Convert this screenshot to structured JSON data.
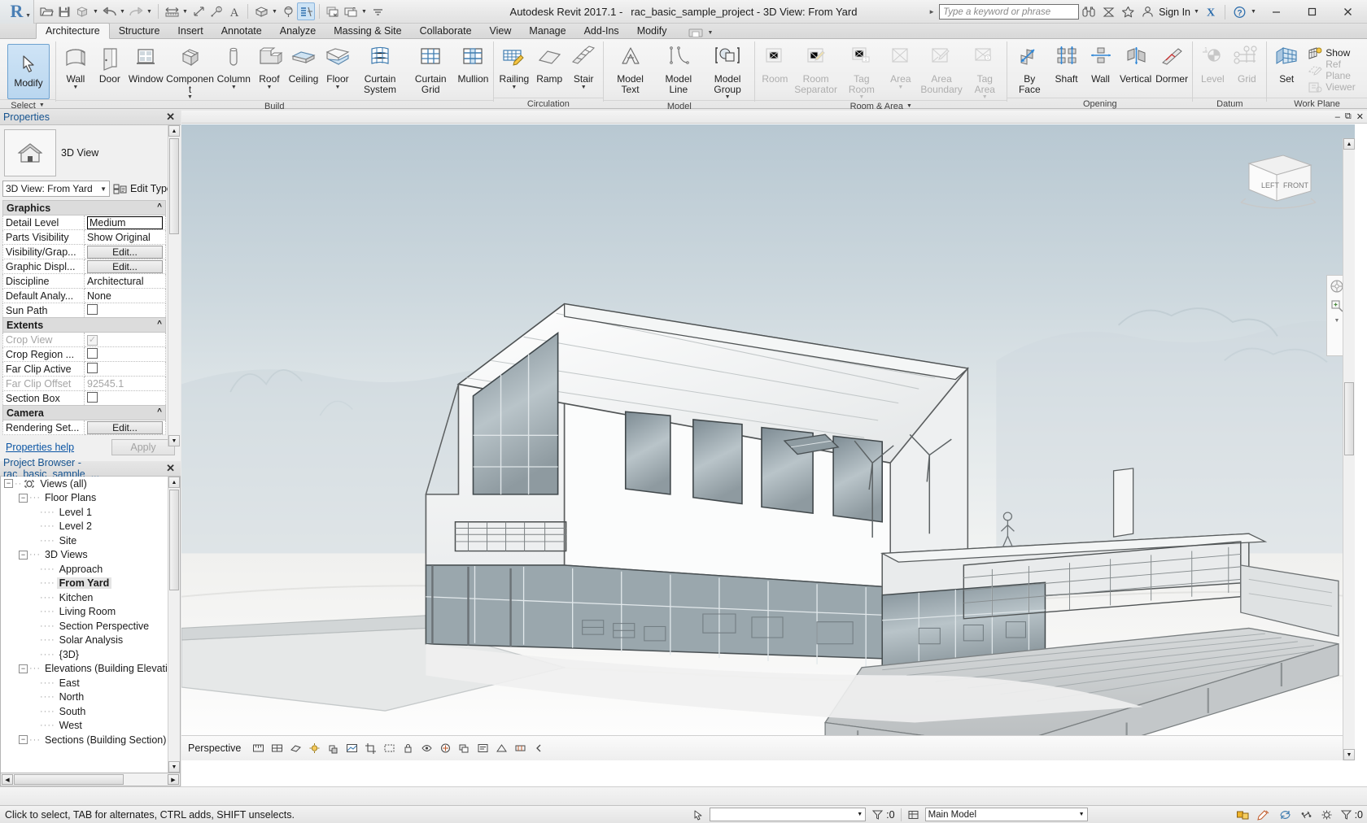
{
  "titlebar": {
    "app_title": "Autodesk Revit 2017.1 -",
    "document_title": "rac_basic_sample_project - 3D View: From Yard",
    "search_placeholder": "Type a keyword or phrase",
    "sign_in_label": "Sign In",
    "qat_items": [
      {
        "name": "open-icon",
        "label": "Open"
      },
      {
        "name": "save-icon",
        "label": "Save"
      },
      {
        "name": "export-icon",
        "label": "Export"
      },
      {
        "name": "undo-icon",
        "label": "Undo"
      },
      {
        "name": "redo-icon",
        "label": "Redo"
      },
      {
        "name": "measure-icon",
        "label": "Measure"
      },
      {
        "name": "aligned-dimension-icon",
        "label": "Aligned Dimension"
      },
      {
        "name": "tag-icon",
        "label": "Tag by Category"
      },
      {
        "name": "text-icon",
        "label": "Text"
      },
      {
        "name": "default-3d-view-icon",
        "label": "Default 3D View"
      },
      {
        "name": "section-icon",
        "label": "Section"
      },
      {
        "name": "thin-lines-icon",
        "label": "Thin Lines"
      },
      {
        "name": "close-hidden-windows-icon",
        "label": "Close Hidden Windows"
      },
      {
        "name": "switch-windows-icon",
        "label": "Switch Windows"
      },
      {
        "name": "customize-qat-icon",
        "label": "Customize Quick Access Toolbar"
      }
    ],
    "window_buttons": {
      "minimize": "–",
      "maximize": "❐",
      "close": "✕"
    }
  },
  "tabs": [
    {
      "label": "Architecture",
      "active": true
    },
    {
      "label": "Structure",
      "active": false
    },
    {
      "label": "Insert",
      "active": false
    },
    {
      "label": "Annotate",
      "active": false
    },
    {
      "label": "Analyze",
      "active": false
    },
    {
      "label": "Massing & Site",
      "active": false
    },
    {
      "label": "Collaborate",
      "active": false
    },
    {
      "label": "View",
      "active": false
    },
    {
      "label": "Manage",
      "active": false
    },
    {
      "label": "Add-Ins",
      "active": false
    },
    {
      "label": "Modify",
      "active": false
    }
  ],
  "ribbon": {
    "modify_label": "Modify",
    "select_label": "Select",
    "panels": [
      {
        "title": "Build",
        "buttons": [
          {
            "label": "Wall",
            "icon": "wall-icon",
            "dropdown": true,
            "disabled": false
          },
          {
            "label": "Door",
            "icon": "door-icon",
            "dropdown": false,
            "disabled": false
          },
          {
            "label": "Window",
            "icon": "window-icon",
            "dropdown": false,
            "disabled": false
          },
          {
            "label": "Component",
            "icon": "component-icon",
            "dropdown": true,
            "disabled": false
          },
          {
            "label": "Column",
            "icon": "column-icon",
            "dropdown": true,
            "disabled": false
          },
          {
            "label": "Roof",
            "icon": "roof-icon",
            "dropdown": true,
            "disabled": false
          },
          {
            "label": "Ceiling",
            "icon": "ceiling-icon",
            "dropdown": false,
            "disabled": false
          },
          {
            "label": "Floor",
            "icon": "floor-icon",
            "dropdown": true,
            "disabled": false
          },
          {
            "label": "Curtain System",
            "icon": "curtain-system-icon",
            "dropdown": false,
            "disabled": false
          },
          {
            "label": "Curtain Grid",
            "icon": "curtain-grid-icon",
            "dropdown": false,
            "disabled": false
          },
          {
            "label": "Mullion",
            "icon": "mullion-icon",
            "dropdown": false,
            "disabled": false
          }
        ]
      },
      {
        "title": "Circulation",
        "buttons": [
          {
            "label": "Railing",
            "icon": "railing-icon",
            "dropdown": true,
            "disabled": false
          },
          {
            "label": "Ramp",
            "icon": "ramp-icon",
            "dropdown": false,
            "disabled": false
          },
          {
            "label": "Stair",
            "icon": "stair-icon",
            "dropdown": true,
            "disabled": false
          }
        ]
      },
      {
        "title": "Model",
        "buttons": [
          {
            "label": "Model Text",
            "icon": "model-text-icon",
            "dropdown": false,
            "disabled": false
          },
          {
            "label": "Model Line",
            "icon": "model-line-icon",
            "dropdown": false,
            "disabled": false
          },
          {
            "label": "Model Group",
            "icon": "model-group-icon",
            "dropdown": true,
            "disabled": false
          }
        ]
      },
      {
        "title": "Room & Area",
        "dropdown_title": true,
        "buttons": [
          {
            "label": "Room",
            "icon": "room-icon",
            "dropdown": false,
            "disabled": true
          },
          {
            "label": "Room Separator",
            "icon": "room-separator-icon",
            "dropdown": false,
            "disabled": true
          },
          {
            "label": "Tag Room",
            "icon": "tag-room-icon",
            "dropdown": true,
            "disabled": true
          },
          {
            "label": "Area",
            "icon": "area-icon",
            "dropdown": true,
            "disabled": true
          },
          {
            "label": "Area Boundary",
            "icon": "area-boundary-icon",
            "dropdown": false,
            "disabled": true
          },
          {
            "label": "Tag Area",
            "icon": "tag-area-icon",
            "dropdown": true,
            "disabled": true
          }
        ]
      },
      {
        "title": "Opening",
        "buttons": [
          {
            "label": "By Face",
            "icon": "opening-by-face-icon",
            "dropdown": false,
            "disabled": false
          },
          {
            "label": "Shaft",
            "icon": "shaft-opening-icon",
            "dropdown": false,
            "disabled": false
          },
          {
            "label": "Wall",
            "icon": "wall-opening-icon",
            "dropdown": false,
            "disabled": false
          },
          {
            "label": "Vertical",
            "icon": "vertical-opening-icon",
            "dropdown": false,
            "disabled": false
          },
          {
            "label": "Dormer",
            "icon": "dormer-opening-icon",
            "dropdown": false,
            "disabled": false
          }
        ]
      },
      {
        "title": "Datum",
        "buttons": [
          {
            "label": "Level",
            "icon": "level-icon",
            "dropdown": false,
            "disabled": true
          },
          {
            "label": "Grid",
            "icon": "grid-icon",
            "dropdown": false,
            "disabled": true
          }
        ]
      },
      {
        "title": "Work Plane",
        "buttons": [
          {
            "label": "Set",
            "icon": "set-workplane-icon",
            "dropdown": false,
            "disabled": false
          }
        ],
        "stack": [
          {
            "label": "Show",
            "icon": "show-workplane-icon",
            "disabled": false
          },
          {
            "label": "Ref Plane",
            "icon": "ref-plane-icon",
            "disabled": true
          },
          {
            "label": "Viewer",
            "icon": "workplane-viewer-icon",
            "disabled": true
          }
        ]
      }
    ]
  },
  "properties": {
    "header": "Properties",
    "type_label": "3D View",
    "instance_selector": "3D View: From Yard",
    "edit_type_label": "Edit Type",
    "help_label": "Properties help",
    "apply_label": "Apply",
    "groups": [
      {
        "name": "Graphics",
        "rows": [
          {
            "name": "Detail Level",
            "value": "Medium",
            "kind": "textbox",
            "disabled": false
          },
          {
            "name": "Parts Visibility",
            "value": "Show Original",
            "kind": "text",
            "disabled": false
          },
          {
            "name": "Visibility/Grap...",
            "value": "Edit...",
            "kind": "button",
            "disabled": false
          },
          {
            "name": "Graphic Displ...",
            "value": "Edit...",
            "kind": "button",
            "disabled": false
          },
          {
            "name": "Discipline",
            "value": "Architectural",
            "kind": "text",
            "disabled": false
          },
          {
            "name": "Default Analy...",
            "value": "None",
            "kind": "text",
            "disabled": false
          },
          {
            "name": "Sun Path",
            "value": "",
            "kind": "checkbox",
            "checked": false,
            "disabled": false
          }
        ]
      },
      {
        "name": "Extents",
        "rows": [
          {
            "name": "Crop View",
            "value": "",
            "kind": "checkbox",
            "checked": true,
            "disabled": true
          },
          {
            "name": "Crop Region ...",
            "value": "",
            "kind": "checkbox",
            "checked": false,
            "disabled": false
          },
          {
            "name": "Far Clip Active",
            "value": "",
            "kind": "checkbox",
            "checked": false,
            "disabled": false
          },
          {
            "name": "Far Clip Offset",
            "value": "92545.1",
            "kind": "text",
            "disabled": true
          },
          {
            "name": "Section Box",
            "value": "",
            "kind": "checkbox",
            "checked": false,
            "disabled": false
          }
        ]
      },
      {
        "name": "Camera",
        "rows": [
          {
            "name": "Rendering Set...",
            "value": "Edit...",
            "kind": "button",
            "disabled": false
          }
        ]
      }
    ]
  },
  "project_browser": {
    "header": "Project Browser - rac_basic_sample_...",
    "nodes": [
      {
        "label": "Views (all)",
        "depth": 0,
        "expander": "-",
        "icon": "views-all-icon",
        "selected": false
      },
      {
        "label": "Floor Plans",
        "depth": 1,
        "expander": "-",
        "selected": false
      },
      {
        "label": "Level 1",
        "depth": 2,
        "expander": "",
        "selected": false
      },
      {
        "label": "Level 2",
        "depth": 2,
        "expander": "",
        "selected": false
      },
      {
        "label": "Site",
        "depth": 2,
        "expander": "",
        "selected": false
      },
      {
        "label": "3D Views",
        "depth": 1,
        "expander": "-",
        "selected": false
      },
      {
        "label": "Approach",
        "depth": 2,
        "expander": "",
        "selected": false
      },
      {
        "label": "From Yard",
        "depth": 2,
        "expander": "",
        "selected": true
      },
      {
        "label": "Kitchen",
        "depth": 2,
        "expander": "",
        "selected": false
      },
      {
        "label": "Living Room",
        "depth": 2,
        "expander": "",
        "selected": false
      },
      {
        "label": "Section Perspective",
        "depth": 2,
        "expander": "",
        "selected": false
      },
      {
        "label": "Solar Analysis",
        "depth": 2,
        "expander": "",
        "selected": false
      },
      {
        "label": "{3D}",
        "depth": 2,
        "expander": "",
        "selected": false
      },
      {
        "label": "Elevations (Building Elevation",
        "depth": 1,
        "expander": "-",
        "selected": false
      },
      {
        "label": "East",
        "depth": 2,
        "expander": "",
        "selected": false
      },
      {
        "label": "North",
        "depth": 2,
        "expander": "",
        "selected": false
      },
      {
        "label": "South",
        "depth": 2,
        "expander": "",
        "selected": false
      },
      {
        "label": "West",
        "depth": 2,
        "expander": "",
        "selected": false
      },
      {
        "label": "Sections (Building Section)",
        "depth": 1,
        "expander": "-",
        "selected": false
      }
    ]
  },
  "viewcube": {
    "left_label": "LEFT",
    "front_label": "FRONT"
  },
  "view_control_bar": {
    "visual_style_label": "Perspective",
    "icons": [
      {
        "name": "scale-icon"
      },
      {
        "name": "detail-level-icon"
      },
      {
        "name": "visual-style-icon"
      },
      {
        "name": "sun-path-icon"
      },
      {
        "name": "shadows-icon"
      },
      {
        "name": "rendering-dialog-icon"
      },
      {
        "name": "crop-view-icon"
      },
      {
        "name": "show-crop-region-icon"
      },
      {
        "name": "lock-3d-view-icon"
      },
      {
        "name": "temporary-hide-isolate-icon"
      },
      {
        "name": "reveal-hidden-elements-icon"
      },
      {
        "name": "worksharing-display-icon"
      },
      {
        "name": "temporary-view-properties-icon"
      },
      {
        "name": "hide-analytical-model-icon"
      },
      {
        "name": "reveal-constraints-icon"
      },
      {
        "name": "expand-view-bar-icon"
      }
    ]
  },
  "statusbar": {
    "message": "Click to select, TAB for alternates, CTRL adds, SHIFT unselects.",
    "filter_placeholder": "",
    "selection_count": ":0",
    "model_label": "Main Model",
    "exclude_count": ":0",
    "icons": [
      {
        "name": "press-drag-icon"
      },
      {
        "name": "filter-icon"
      },
      {
        "name": "design-options-icon"
      },
      {
        "name": "worksets-icon"
      },
      {
        "name": "editing-request-icon"
      },
      {
        "name": "sync-icon"
      },
      {
        "name": "settings-icon"
      },
      {
        "name": "exclude-options-icon"
      }
    ]
  }
}
